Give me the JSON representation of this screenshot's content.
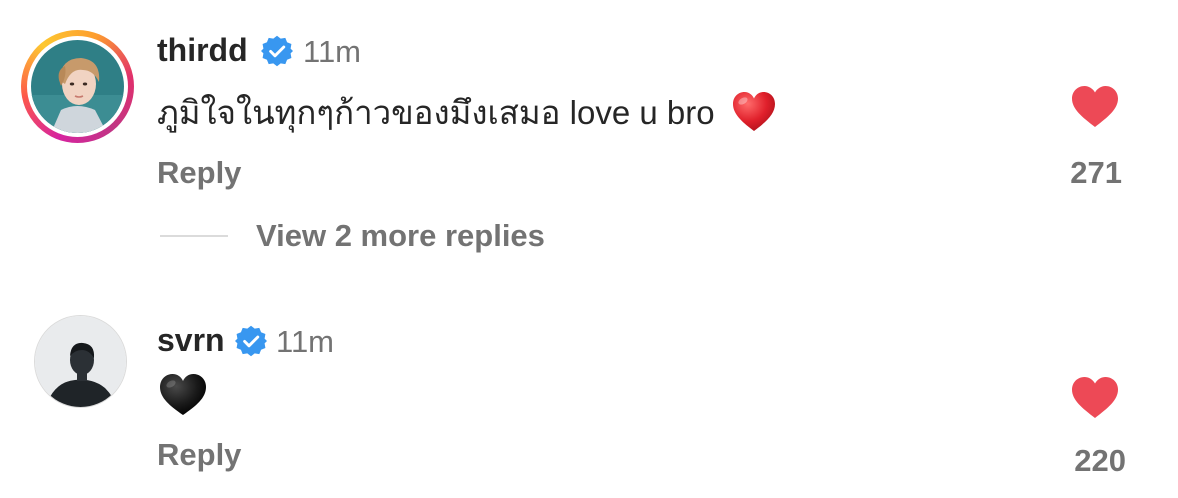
{
  "comments": [
    {
      "username": "thirdd",
      "time": "11m",
      "text": "ภูมิใจในทุกๆก้าวของมึงเสมอ love u bro",
      "text_emoji": "red-heart",
      "reply_label": "Reply",
      "like_count": "271",
      "has_story_ring": true
    },
    {
      "username": "svrn",
      "time": "11m",
      "text": "",
      "text_emoji": "black-heart",
      "reply_label": "Reply",
      "like_count": "220",
      "has_story_ring": false
    }
  ],
  "view_more_replies": "View 2 more replies",
  "colors": {
    "verified_blue": "#3897f0",
    "like_red": "#ed4956",
    "text_primary": "#262626",
    "text_secondary": "#737373"
  },
  "icons": {
    "verified": "verified-badge-icon",
    "like": "heart-filled-icon",
    "red_heart_emoji": "red-heart-emoji-icon",
    "black_heart_emoji": "black-heart-emoji-icon"
  }
}
